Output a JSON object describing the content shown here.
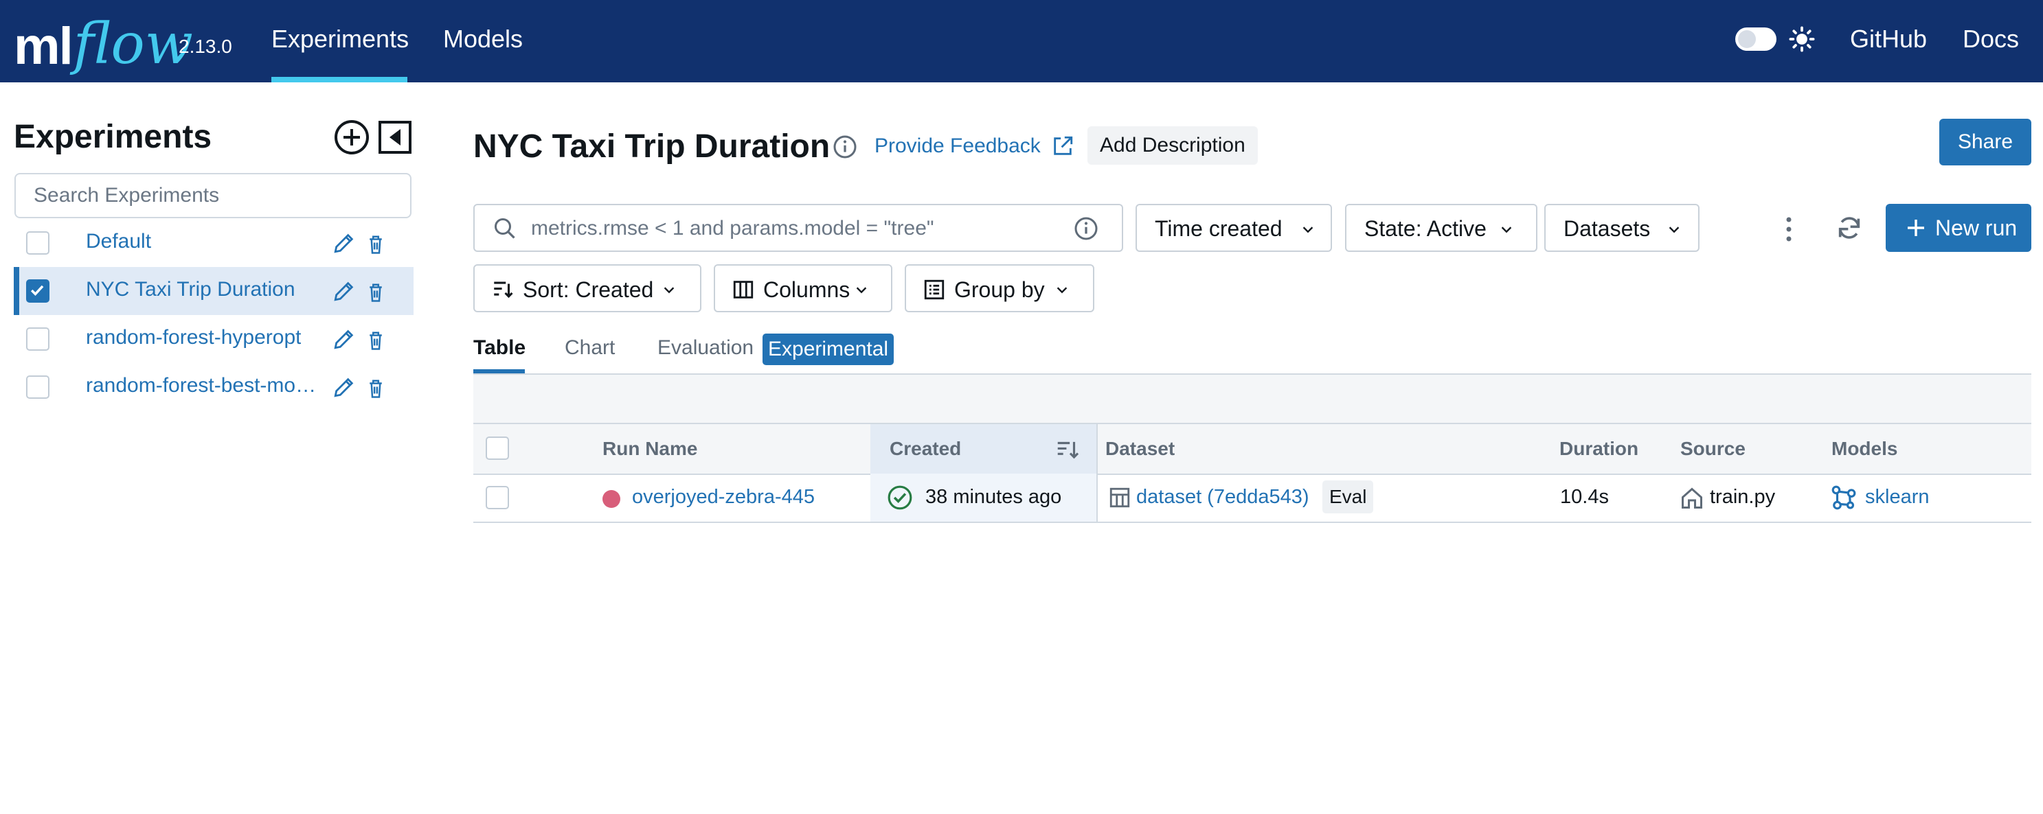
{
  "nav": {
    "logo_ml": "ml",
    "logo_flow": "flow",
    "version": "2.13.0",
    "links": [
      "Experiments",
      "Models"
    ],
    "github": "GitHub",
    "docs": "Docs"
  },
  "sidebar": {
    "title": "Experiments",
    "search_placeholder": "Search Experiments",
    "items": [
      {
        "name": "Default",
        "checked": false
      },
      {
        "name": "NYC Taxi Trip Duration",
        "checked": true
      },
      {
        "name": "random-forest-hyperopt",
        "checked": false
      },
      {
        "name": "random-forest-best-mo…",
        "checked": false
      }
    ]
  },
  "main": {
    "title": "NYC Taxi Trip Duration",
    "feedback": "Provide Feedback",
    "add_description": "Add Description",
    "share": "Share",
    "search_placeholder": "metrics.rmse < 1 and params.model = \"tree\"",
    "filters": {
      "time": "Time created",
      "state": "State: Active",
      "datasets": "Datasets"
    },
    "new_run": "New run",
    "controls": {
      "sort": "Sort: Created",
      "columns": "Columns",
      "group": "Group by"
    },
    "tabs": [
      "Table",
      "Chart",
      "Evaluation"
    ],
    "experimental_badge": "Experimental"
  },
  "table": {
    "headers": {
      "run_name": "Run Name",
      "created": "Created",
      "dataset": "Dataset",
      "duration": "Duration",
      "source": "Source",
      "models": "Models"
    },
    "rows": [
      {
        "run_name": "overjoyed-zebra-445",
        "created": "38 minutes ago",
        "dataset": "dataset (7edda543)",
        "dataset_tag": "Eval",
        "duration": "10.4s",
        "source": "train.py",
        "model": "sklearn"
      }
    ]
  },
  "colors": {
    "nav_bg": "#11316e",
    "accent": "#2272b4",
    "logo_flow": "#43c9ed",
    "run_dot": "#d85e7a",
    "success": "#277c43"
  }
}
